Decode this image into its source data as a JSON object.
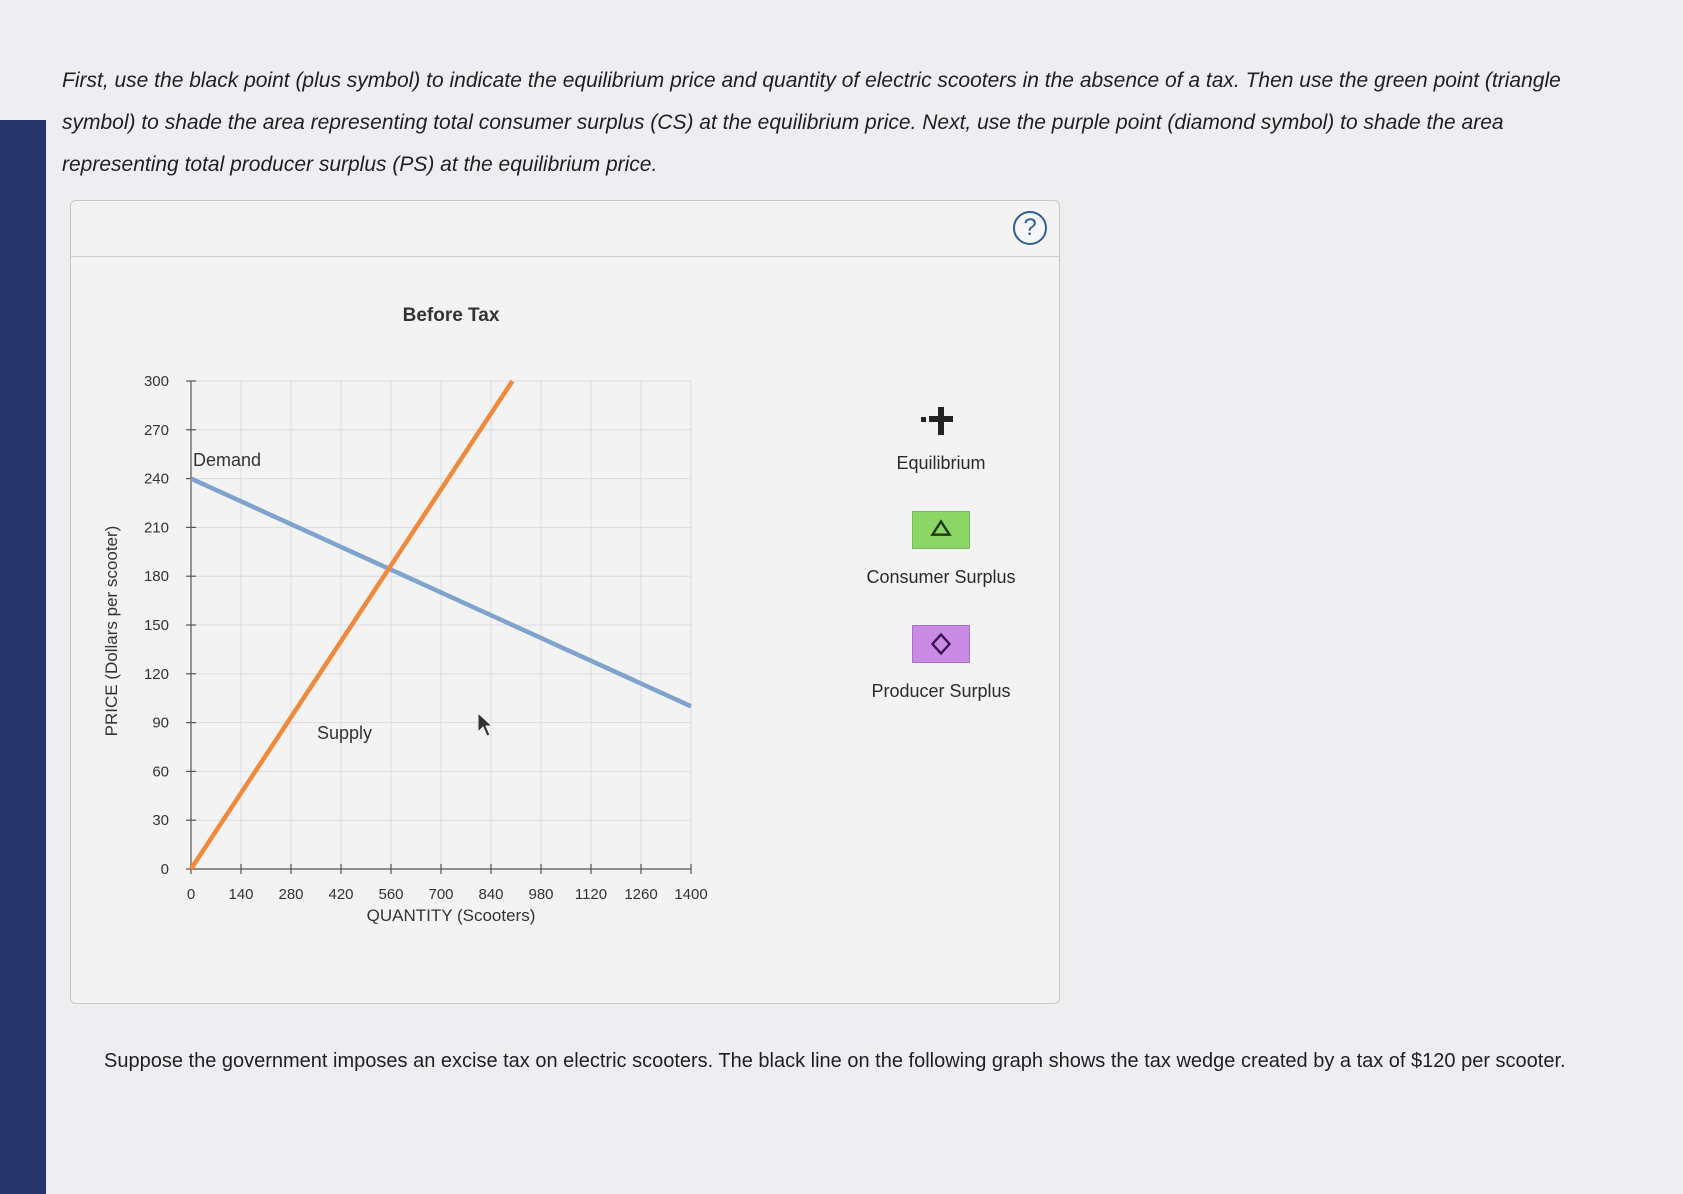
{
  "instructions": "First, use the black point (plus symbol) to indicate the equilibrium price and quantity of electric scooters in the absence of a tax. Then use the green point (triangle symbol) to shade the area representing total consumer surplus (CS) at the equilibrium price. Next, use the purple point (diamond symbol) to shade the area representing total producer surplus (PS) at the equilibrium price.",
  "help_label": "?",
  "legend": {
    "equilibrium": "Equilibrium",
    "consumer_surplus": "Consumer Surplus",
    "producer_surplus": "Producer Surplus"
  },
  "colors": {
    "demand": "#7fa3cc",
    "supply": "#f08a3a",
    "consumer_tool": "#8cd665",
    "producer_tool": "#c98be6"
  },
  "question": "Suppose the government imposes an excise tax on electric scooters. The black line on the following graph shows the tax wedge created by a tax of $120 per scooter.",
  "chart_data": {
    "type": "line",
    "title": "Before Tax",
    "xlabel": "QUANTITY (Scooters)",
    "ylabel": "PRICE (Dollars per scooter)",
    "xlim": [
      0,
      1400
    ],
    "ylim": [
      0,
      300
    ],
    "x_ticks": [
      0,
      140,
      280,
      420,
      560,
      700,
      840,
      980,
      1120,
      1260,
      1400
    ],
    "y_ticks": [
      0,
      30,
      60,
      90,
      120,
      150,
      180,
      210,
      240,
      270,
      300
    ],
    "grid": true,
    "series": [
      {
        "name": "Demand",
        "color": "#7fa3cc",
        "x": [
          0,
          1400
        ],
        "y": [
          240,
          100
        ]
      },
      {
        "name": "Supply",
        "color": "#f08a3a",
        "x": [
          0,
          900
        ],
        "y": [
          0,
          300
        ]
      }
    ]
  }
}
